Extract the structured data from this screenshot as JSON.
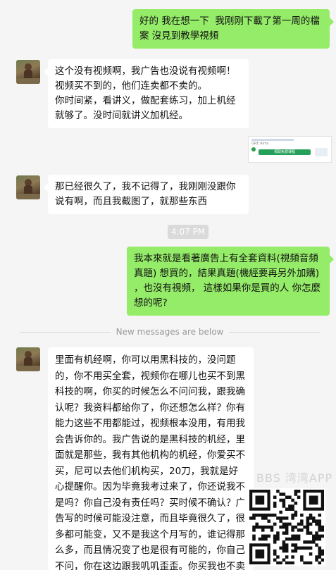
{
  "messages": [
    {
      "side": "out",
      "text": "好的 我在想一下  我刚刚下載了第一周的檔案 沒見到教學視頻"
    },
    {
      "side": "in",
      "text": "这个没有视频啊，我广告也没说有视频啊！视频买不到的，他们连卖都不卖的。\n你时间紧，看讲义，做配套练习，加上机经就够了。没时间就讲义加机经。"
    },
    {
      "side": "in",
      "text": "那已经很久了，我不记得了，我刚刚没跟你说有啊，而且我截图了，就那些东西"
    },
    {
      "side": "out",
      "text": "我本來就是看著廣告上有全套資料(視頻音頻真題) 想買的，結果真題(機經要再另外加購) ，也沒有視頻， 這樣如果你是買的人 你怎麼想的呢?"
    },
    {
      "side": "in",
      "text": "里面有机经啊，你可以用黑科技的，没问题的，你不用买全套，视频你在哪儿也买不到黑科技的啊，你买的时候怎么不问问我，跟我确认呢？我资料都给你了，你还想怎么样？你有能力这些不用都能过，视频根本没用，有用我会告诉你的。我广告说的是黑科技的机经，里面就是那些，我有其他机构的机经，你爱买不买，尼可以去他们机构买，20刀，我就是好心提醒你。因为毕竟我考过来了，你还说我不是吗？你自己没有责任吗？买时候不确认？广告写的时候可能没注意，而且毕竟很久了，很多都可能变，又不是我这个月写的，谁记得那么多，而且情况变了也是很有可能的，你自己不问，你在这边跟我叽叽歪歪。你买我也不卖了，什么态度啊"
    }
  ],
  "timestamp": "4:07 PM",
  "divider_text": "New messages are below",
  "thumbnail": {
    "button_label": "领取免费课程",
    "header_text": "GRE Aims"
  },
  "watermark": "BBS 湾湾APP",
  "colors": {
    "incoming": "#ffffff",
    "outgoing": "#95ec69",
    "background": "#f5f5f5"
  }
}
